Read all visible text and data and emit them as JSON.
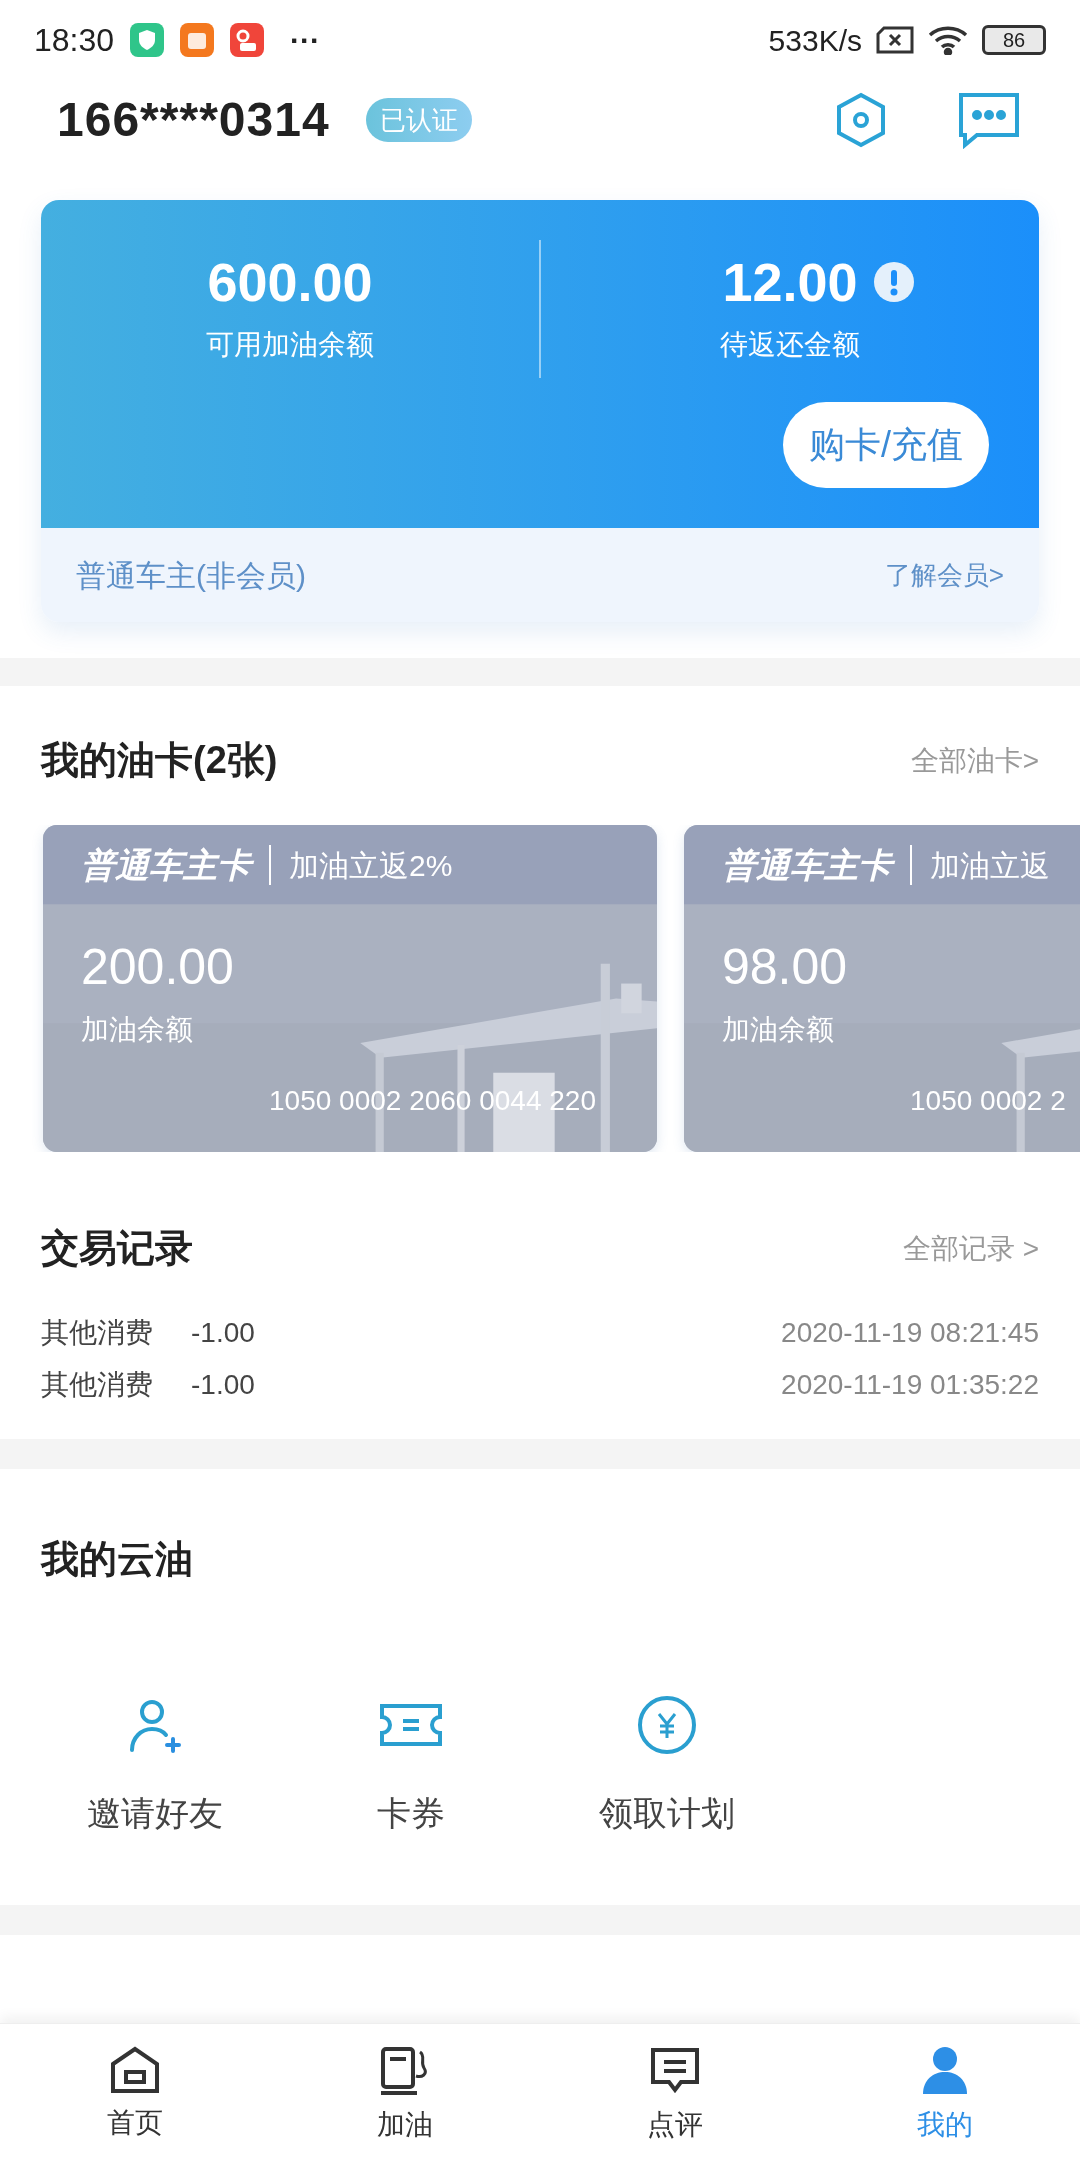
{
  "status_bar": {
    "time": "18:30",
    "more": "···",
    "speed": "533K/s",
    "battery": "86"
  },
  "header": {
    "phone": "166****0314",
    "badge": "已认证"
  },
  "balance": {
    "available_amount": "600.00",
    "available_label": "可用加油余额",
    "pending_amount": "12.00",
    "pending_label": "待返还金额",
    "action": "购卡/充值",
    "membership": "普通车主(非会员)",
    "membership_link": "了解会员>"
  },
  "oil_cards": {
    "title": "我的油卡(2张)",
    "link": "全部油卡>",
    "cards": [
      {
        "name": "普通车主卡",
        "benefit": "加油立返2%",
        "amount": "200.00",
        "amount_label": "加油余额",
        "number": "1050 0002 2060 0044 220"
      },
      {
        "name": "普通车主卡",
        "benefit": "加油立返",
        "amount": "98.00",
        "amount_label": "加油余额",
        "number": "1050 0002 2"
      }
    ]
  },
  "transactions": {
    "title": "交易记录",
    "link": "全部记录 >",
    "rows": [
      {
        "type": "其他消费",
        "amount": "-1.00",
        "time": "2020-11-19 08:21:45"
      },
      {
        "type": "其他消费",
        "amount": "-1.00",
        "time": "2020-11-19 01:35:22"
      }
    ]
  },
  "my_yunyou": {
    "title": "我的云油",
    "items": [
      {
        "kind": "invite",
        "label": "邀请好友"
      },
      {
        "kind": "coupon",
        "label": "卡券"
      },
      {
        "kind": "plan",
        "label": "领取计划"
      }
    ]
  },
  "bottom_nav": [
    {
      "kind": "home",
      "label": "首页",
      "selected": false
    },
    {
      "kind": "fuel",
      "label": "加油",
      "selected": false
    },
    {
      "kind": "review",
      "label": "点评",
      "selected": false
    },
    {
      "kind": "me",
      "label": "我的",
      "selected": true
    }
  ]
}
